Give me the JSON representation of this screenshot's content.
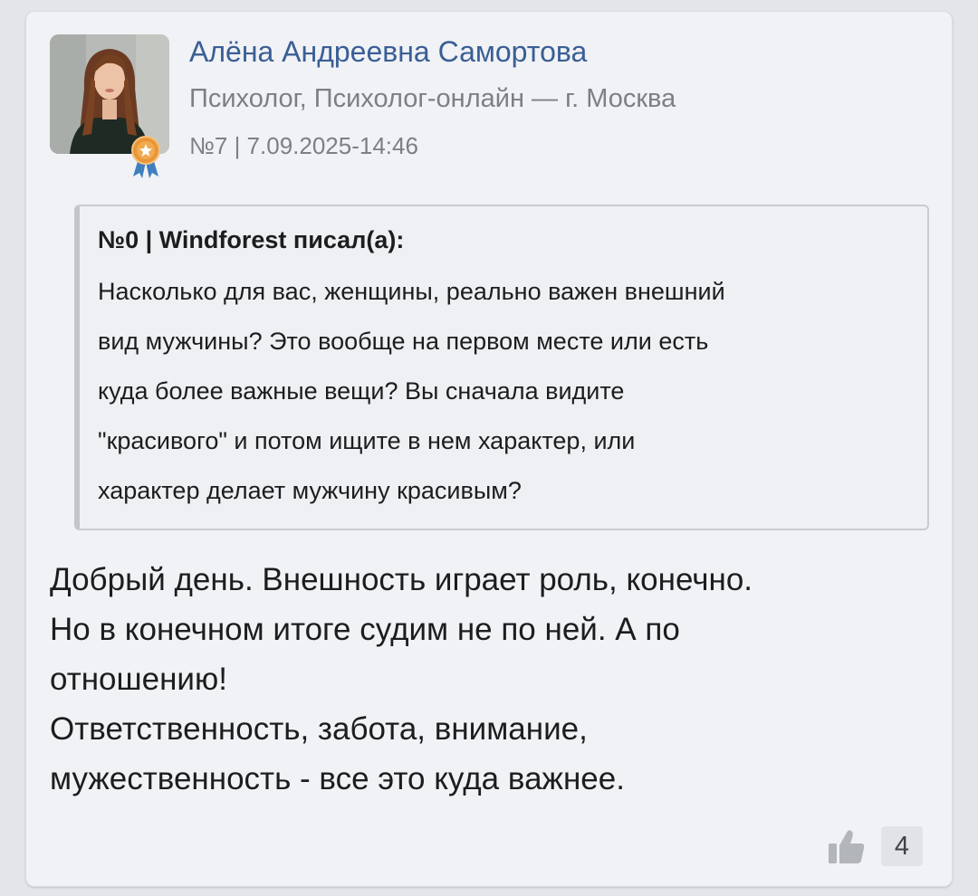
{
  "post": {
    "author_name": "Алёна Андреевна Самортова",
    "author_role": "Психолог, Психолог-онлайн — г. Москва",
    "meta": "№7 | 7.09.2025-14:46",
    "quote": {
      "header": "№0 | Windforest писал(а):",
      "lines": [
        "Насколько для вас, женщины, реально важен внешний",
        "вид мужчины? Это вообще на первом месте или есть",
        "куда более важные вещи? Вы сначала видите",
        "\"красивого\" и потом ищите в нем характер, или",
        "характер делает мужчину красивым?"
      ]
    },
    "body_lines": [
      "Добрый день. Внешность играет роль, конечно.",
      "Но в конечном итоге судим не по ней. А по",
      "отношению!",
      "Ответственность, забота, внимание,",
      "мужественность - все это куда важнее."
    ],
    "likes": {
      "icon": "thumbs-up-icon",
      "count": "4"
    }
  },
  "colors": {
    "card_bg": "#f0f2f5",
    "author_name": "#3a5e95",
    "muted_text": "#7c7f84",
    "badge": "#e8963a"
  }
}
